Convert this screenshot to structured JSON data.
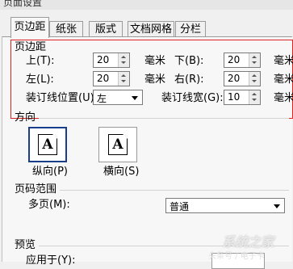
{
  "window": {
    "title": "页面设置"
  },
  "tabs": [
    {
      "label": "页边距",
      "active": true
    },
    {
      "label": "纸张",
      "active": false
    },
    {
      "label": "版式",
      "active": false
    },
    {
      "label": "文档网格",
      "active": false
    },
    {
      "label": "分栏",
      "active": false
    }
  ],
  "margins": {
    "group_label": "页边距",
    "unit": "毫米",
    "top": {
      "label": "上(T):",
      "value": "20"
    },
    "bottom": {
      "label": "下(B):",
      "value": "20"
    },
    "left": {
      "label": "左(L):",
      "value": "20"
    },
    "right": {
      "label": "右(R):",
      "value": "20"
    },
    "gutter_position": {
      "label": "装订线位置(U):",
      "value": "左"
    },
    "gutter": {
      "label": "装订线宽(G):",
      "value": "10"
    }
  },
  "orientation": {
    "group_label": "方向",
    "icon_letter": "A",
    "portrait_label": "纵向(P)",
    "landscape_label": "横向(S)",
    "selected": "portrait"
  },
  "pages": {
    "group_label": "页码范围",
    "multiple_label": "多页(M):",
    "multiple_value": "普通"
  },
  "preview": {
    "group_label": "预览",
    "apply_label": "应用于(Y):"
  },
  "watermark": {
    "brand": "系统之家",
    "caption": "头条号 / 电子卡"
  },
  "colors": {
    "highlight_border": "#dd2222",
    "selected_border": "#1a3e8c"
  }
}
